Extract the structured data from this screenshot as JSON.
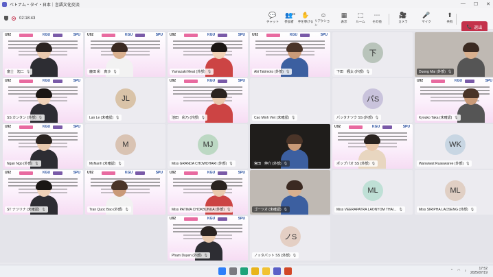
{
  "window": {
    "title": "ベトナム・タイ・日本｜言語文化交流",
    "minimize": "—",
    "maximize": "☐",
    "close": "✕"
  },
  "meeting": {
    "elapsed": "02:18:43"
  },
  "toolbar": {
    "items": [
      {
        "key": "chat",
        "label": "チャット",
        "icon": "💬"
      },
      {
        "key": "people",
        "label": "参加者",
        "icon": "👥",
        "count": "26"
      },
      {
        "key": "raise",
        "label": "手を挙げる",
        "icon": "✋"
      },
      {
        "key": "react",
        "label": "リアクション",
        "icon": "☺"
      },
      {
        "key": "view",
        "label": "表示",
        "icon": "▦"
      },
      {
        "key": "rooms",
        "label": "ルーム",
        "icon": "⬚"
      },
      {
        "key": "more",
        "label": "その他",
        "icon": "⋯"
      },
      {
        "key": "camera",
        "label": "カメラ",
        "icon": "🎥"
      },
      {
        "key": "mic",
        "label": "マイク",
        "icon": "🎤"
      },
      {
        "key": "share",
        "label": "共有",
        "icon": "⬆"
      }
    ],
    "leave": {
      "label": "退出",
      "icon": "📞"
    }
  },
  "slide": {
    "left_logo": "U92",
    "center_logo": "KGU",
    "right_logo": "SPU"
  },
  "participants": [
    {
      "name": "富士　旭二",
      "type": "slide",
      "person": true
    },
    {
      "name": "鹿田 彩　真沙",
      "type": "slide",
      "person": true
    },
    {
      "name": "Yamazaki Meat (外部)",
      "type": "slide",
      "person": true
    },
    {
      "name": "Aki Takimoto (外部)",
      "type": "slide",
      "person": true
    },
    {
      "name": "下田　楓太 (外部)",
      "type": "avatar",
      "initials": "下",
      "color": "#b9c4bb"
    },
    {
      "name": "Duong Mai (外部)",
      "type": "cam",
      "person": true
    },
    {
      "name": "SS カンタン (外部)",
      "type": "slide",
      "person": true
    },
    {
      "name": "Lan Le (未確認)",
      "type": "avatar",
      "initials": "JL",
      "color": "#d9c3a8"
    },
    {
      "name": "池田　彩乃 (外部)",
      "type": "slide",
      "person": true
    },
    {
      "name": "Cao Minh Viet (未確認)",
      "type": "avatar-blank"
    },
    {
      "name": "パッタナツク SS (外部)",
      "type": "avatar",
      "initials": "パS",
      "color": "#c9c3dc"
    },
    {
      "name": "Kyouko Taka (未確認)",
      "type": "slide",
      "person": true
    },
    {
      "name": "Ngan Ngo (外部)",
      "type": "slide",
      "person": true
    },
    {
      "name": "MyNanh (未確認)",
      "type": "avatar",
      "initials": "M",
      "color": "#d9c3b3"
    },
    {
      "name": "Miss GRANDA CHOWDHARI (外部)",
      "type": "avatar",
      "initials": "MJ",
      "color": "#bcd8c3"
    },
    {
      "name": "宮田　伸介 (外部)",
      "type": "dark",
      "person": true
    },
    {
      "name": "ポップパオ SS (外部)",
      "type": "slide",
      "person": true
    },
    {
      "name": "Wanwiwat Ruawwaree (外部)",
      "type": "avatar",
      "initials": "WK",
      "color": "#c8d6e3"
    },
    {
      "name": "ST ナツリナ (未確認)",
      "type": "slide",
      "person": true
    },
    {
      "name": "Tran Quoc Bao (外部)",
      "type": "slide",
      "person": true
    },
    {
      "name": "Miss PATIMA CHOKBUNUA (外部)",
      "type": "slide",
      "person": true
    },
    {
      "name": "ゴーツオ (未確認)",
      "type": "cam",
      "person": true
    },
    {
      "name": "Miss VEERAPATRA LAONYOM THAI...",
      "type": "avatar",
      "initials": "ML",
      "color": "#bfe0d6"
    },
    {
      "name": "Miss SIRIPHA LAOSENG (外部)",
      "type": "avatar",
      "initials": "ML",
      "color": "#e0cfc4"
    },
    {
      "name": "Pham Duyen (外部)",
      "type": "slide",
      "person": true
    },
    {
      "name": "ノッタパット SS (外部)",
      "type": "avatar",
      "initials": "ノS",
      "color": "#e4cfc4"
    }
  ],
  "taskbar": {
    "apps": [
      {
        "name": "windows",
        "color": "#2d7ff9"
      },
      {
        "name": "search",
        "color": "#7a7a80"
      },
      {
        "name": "edge",
        "color": "#1fa37a"
      },
      {
        "name": "chrome",
        "color": "#e8b41a"
      },
      {
        "name": "explorer",
        "color": "#f1c232"
      },
      {
        "name": "teams",
        "color": "#5b5fc7"
      },
      {
        "name": "powerpoint",
        "color": "#d24726"
      }
    ],
    "time": "17:52",
    "date": "2025/07/19"
  }
}
